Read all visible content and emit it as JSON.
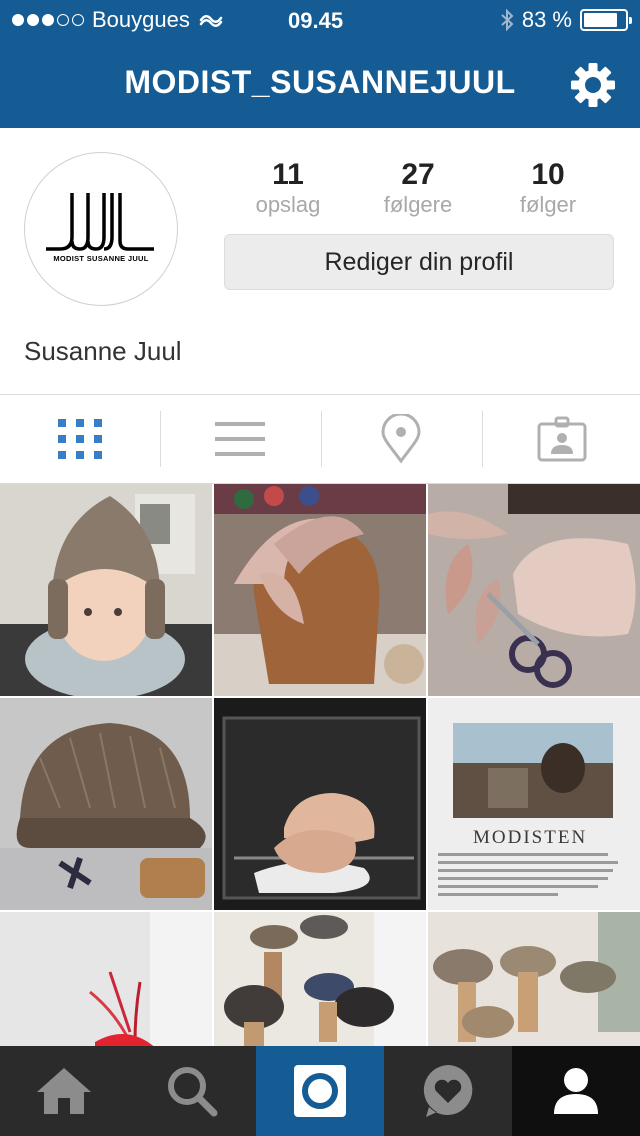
{
  "status_bar": {
    "carrier": "Bouygues",
    "time": "09.45",
    "battery": "83 %",
    "battery_level": 0.83,
    "signal_bars_filled": 3,
    "signal_bars_total": 5
  },
  "nav": {
    "title": "MODIST_SUSANNEJUUL",
    "settings_icon": "gear-icon"
  },
  "profile": {
    "avatar_caption": "MODIST SUSANNE JUUL",
    "name": "Susanne Juul",
    "stats": [
      {
        "count": "11",
        "label": "opslag"
      },
      {
        "count": "27",
        "label": "følgere"
      },
      {
        "count": "10",
        "label": "følger"
      }
    ],
    "edit_button": "Rediger din profil"
  },
  "view_tabs": [
    {
      "icon": "grid-view-icon",
      "active": true
    },
    {
      "icon": "list-view-icon",
      "active": false
    },
    {
      "icon": "location-pin-icon",
      "active": false
    },
    {
      "icon": "tagged-photos-icon",
      "active": false
    }
  ],
  "tab_bar": [
    {
      "icon": "home-icon"
    },
    {
      "icon": "search-icon"
    },
    {
      "icon": "camera-icon",
      "active": true
    },
    {
      "icon": "activity-heart-icon"
    },
    {
      "icon": "profile-icon"
    }
  ],
  "colors": {
    "brand_blue": "#165c94",
    "active_tab_blue": "#3a7cc8",
    "tab_bar_bg": "#2b2b2b"
  }
}
